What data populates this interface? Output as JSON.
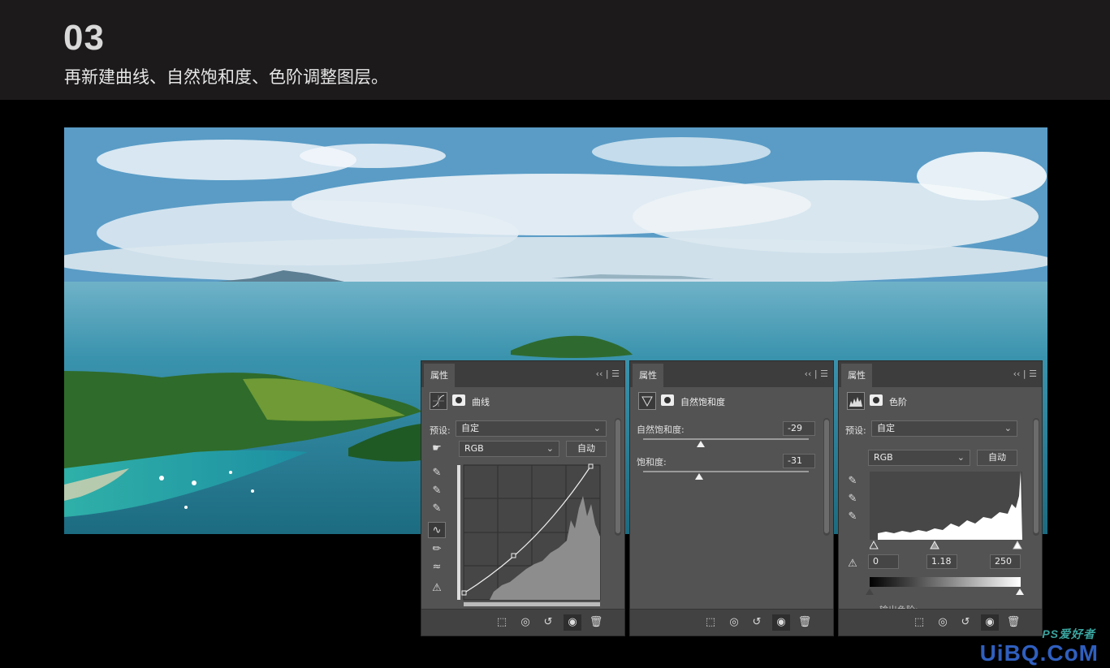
{
  "header": {
    "step": "03",
    "subtitle": "再新建曲线、自然饱和度、色阶调整图层。"
  },
  "panels": {
    "curves": {
      "tab": "属性",
      "title": "曲线",
      "preset_label": "预设:",
      "preset_value": "自定",
      "channel": "RGB",
      "auto": "自动"
    },
    "vibrance": {
      "tab": "属性",
      "title": "自然饱和度",
      "vibrance_label": "自然饱和度:",
      "vibrance_value": "-29",
      "saturation_label": "饱和度:",
      "saturation_value": "-31"
    },
    "levels": {
      "tab": "属性",
      "title": "色阶",
      "preset_label": "预设:",
      "preset_value": "自定",
      "channel": "RGB",
      "auto": "自动",
      "input_black": "0",
      "input_gamma": "1.18",
      "input_white": "250",
      "output_label": "输出色阶:"
    }
  },
  "watermark": {
    "text": "UiBQ.CoM",
    "sub": "PS爱好者"
  },
  "colors": {
    "panel_bg": "#535353",
    "tab_bar": "#3d3d3d",
    "watermark_blue": "#2f5fbf"
  }
}
